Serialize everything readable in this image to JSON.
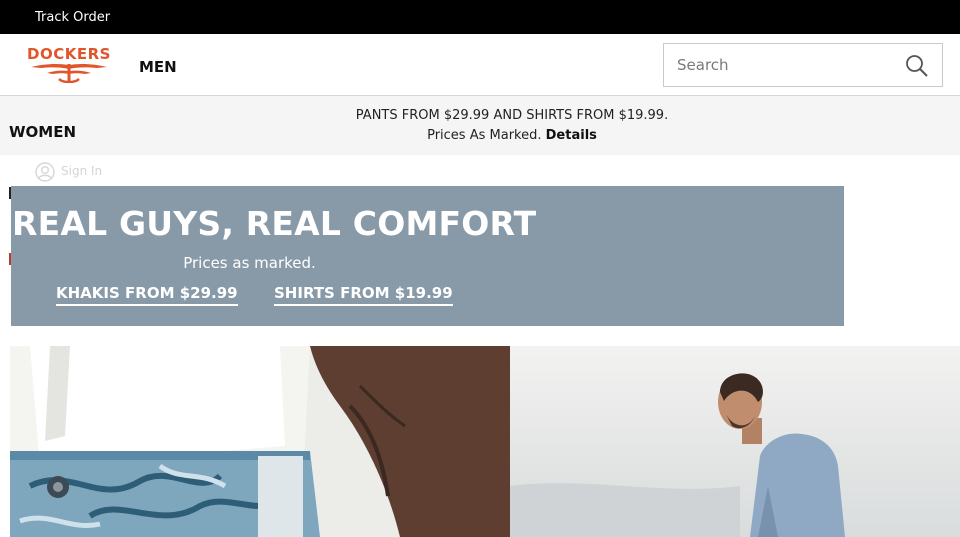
{
  "topbar": {
    "track_order": "Track Order"
  },
  "header": {
    "logo_text": "DOCKERS",
    "nav_men": "MEN",
    "search_placeholder": "Search"
  },
  "promo": {
    "nav_women": "WOMEN",
    "line1": "PANTS FROM $29.99 AND SHIRTS FROM $19.99.",
    "line2": "Prices As Marked.",
    "details_link": "Details"
  },
  "account": {
    "sign_in": "Sign In"
  },
  "hero": {
    "title": "REAL GUYS, REAL COMFORT",
    "subtitle": "Prices as marked.",
    "link_khakis": "KHAKIS FROM $29.99",
    "link_shirts": "SHIRTS FROM $19.99"
  },
  "colors": {
    "brand_orange": "#e0552a",
    "hero_bg": "#8899a8",
    "topbar_bg": "#000000",
    "promo_bg": "#f5f5f5"
  },
  "icons": [
    "dockers-wings-logo",
    "search-icon",
    "account-icon"
  ]
}
